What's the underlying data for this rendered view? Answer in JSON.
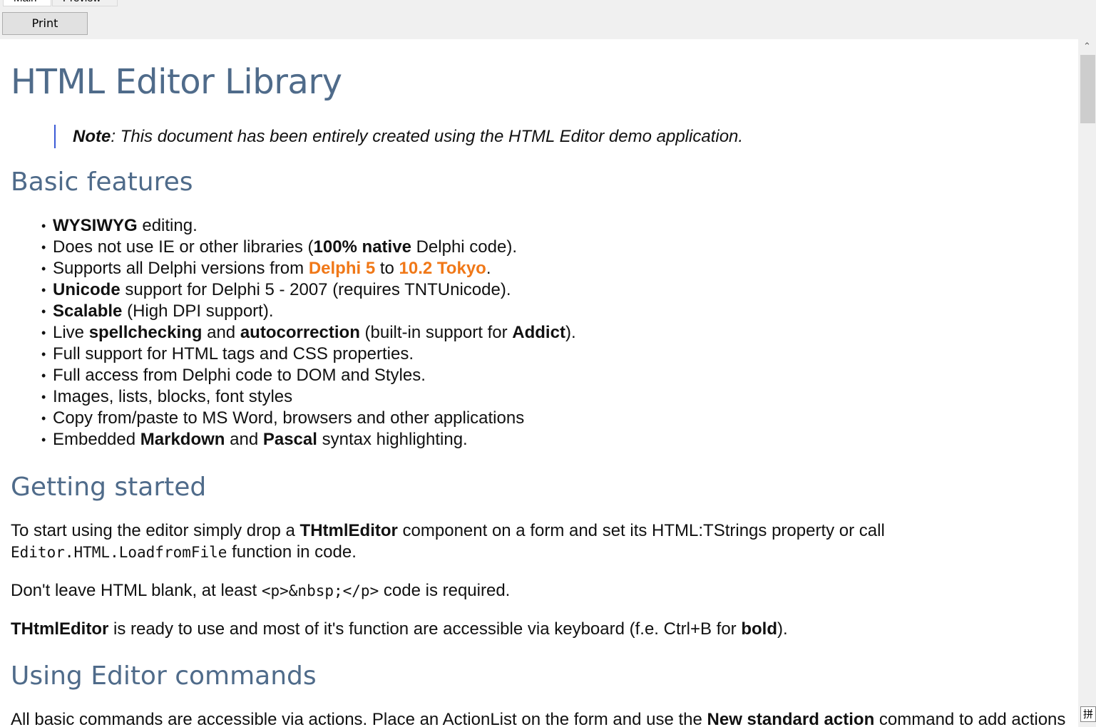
{
  "tabs": [
    {
      "label": "Main"
    },
    {
      "label": "Preview"
    }
  ],
  "toolbar": {
    "print_label": "Print"
  },
  "document": {
    "title": "HTML Editor Library",
    "note": {
      "label": "Note",
      "text": ": This document has been entirely created using the HTML Editor demo application."
    },
    "basic_features": {
      "heading": "Basic features",
      "items": [
        {
          "b1": "WYSIWYG",
          "t1": " editing."
        },
        {
          "t0": "Does not use IE or other libraries (",
          "b1": "100% native",
          "t1": " Delphi code)."
        },
        {
          "t0": "Supports all Delphi versions from ",
          "o1": "Delphi 5",
          "t1": " to ",
          "o2": "10.2 Tokyo",
          "t2": "."
        },
        {
          "b1": "Unicode",
          "t1": " support for Delphi 5 - 2007 (requires TNTUnicode)."
        },
        {
          "b1": "Scalable",
          "t1": " (High DPI  support)."
        },
        {
          "t0": "Live ",
          "b1": "spellchecking",
          "t1": " and ",
          "b2": "autocorrection",
          "t2": " (built-in support for ",
          "b3": "Addict",
          "t3": ")."
        },
        {
          "t0": "Full support for HTML tags and CSS properties."
        },
        {
          "t0": "Full access from Delphi code to DOM and Styles."
        },
        {
          "t0": "Images, lists, blocks, font styles"
        },
        {
          "t0": "Copy from/paste to MS Word, browsers and other applications"
        },
        {
          "t0": "Embedded ",
          "b1": "Markdown",
          "t1": " and ",
          "b2": "Pascal",
          "t2": " syntax highlighting."
        }
      ]
    },
    "getting_started": {
      "heading": "Getting started",
      "p1": {
        "t0": "To start using the editor simply drop a ",
        "b1": "THtmlEditor",
        "t1": " component on a form and set its HTML:TStrings property or call",
        "code": "Editor.HTML.LoadfromFile",
        "t2": " function in code."
      },
      "p2": {
        "t0": "Don't leave HTML blank, at least ",
        "code": "<p>&nbsp;</p>",
        "t1": " code is required."
      },
      "p3": {
        "b0": "THtmlEditor",
        "t0": " is ready to use and most of it's function are accessible via keyboard (f.e. Ctrl+B for ",
        "b1": "bold",
        "t1": ")."
      }
    },
    "using_commands": {
      "heading": "Using Editor commands",
      "p1": {
        "t0": "All basic commands are accessible via actions. Place an ActionList on the form and use the ",
        "b1": "New standard action",
        "t1": " command to add actions"
      }
    }
  },
  "scrollbar": {
    "up_glyph": "⌃"
  },
  "ime_indicator": {
    "glyph": "拼"
  },
  "colors": {
    "heading": "#4f6b8a",
    "accent_orange": "#f07818",
    "note_border": "#3b5ad6"
  }
}
